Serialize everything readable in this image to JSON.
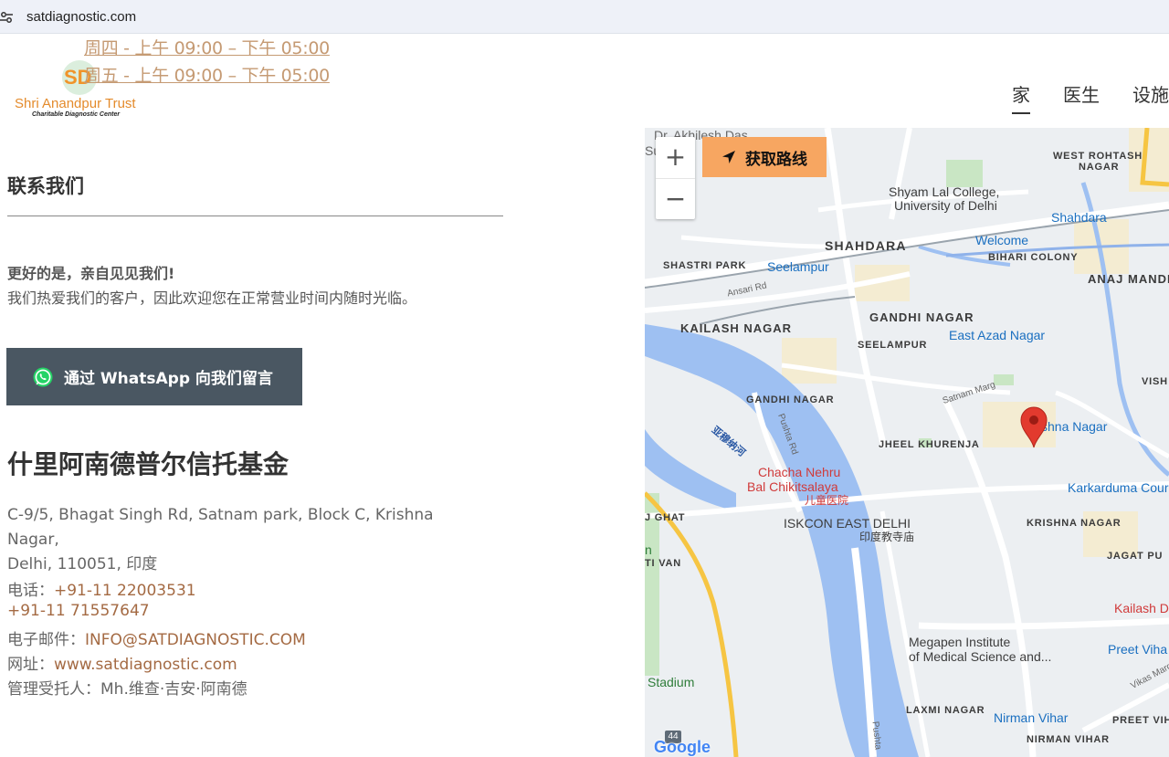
{
  "browser": {
    "url": "satdiagnostic.com"
  },
  "header": {
    "hours": [
      "周四 - 上午 09:00 – 下午 05:00",
      "周五 - 上午 09:00 – 下午 05:00"
    ],
    "logo": {
      "initials": "SD",
      "name": "Shri Anandpur Trust",
      "subtitle": "Charitable Diagnostic Center"
    },
    "nav": [
      "家",
      "医生",
      "设施"
    ]
  },
  "contact": {
    "title": "联系我们",
    "lead_strong": "更好的是，亲自见见我们!",
    "lead_text": "我们热爱我们的客户，因此欢迎您在正常营业时间内随时光临。",
    "whatsapp_label": "通过 WhatsApp 向我们留言",
    "org_name": "什里阿南德普尔信托基金",
    "address_line1": "C-9/5, Bhagat Singh Rd, Satnam park, Block C, Krishna Nagar,",
    "address_line2": "Delhi, 110051, 印度",
    "phone_label": "电话：",
    "phone1": "+91-11 22003531",
    "phone2": "+91-11 71557647",
    "email_label": "电子邮件：",
    "email": "INFO@SATDIAGNOSTIC.COM",
    "website_label": "网址：",
    "website": "www.satdiagnostic.com",
    "trustee_label": "管理受托人：",
    "trustee": "Mh.维查·吉安·阿南德"
  },
  "map": {
    "zoom_in": "+",
    "zoom_out": "−",
    "directions_label": "获取路线",
    "attribution": "Google",
    "highway_shield": "44",
    "labels": {
      "akhilesh": "Dr. Akhilesh Das",
      "su": "Su",
      "west_rohtash": "WEST ROHTASH",
      "nagar_wr": "NAGAR",
      "shyam_lal": "Shyam Lal College,",
      "univ_delhi": "University of Delhi",
      "shahdara_station": "Shahdara",
      "shahdara": "SHAHDARA",
      "welcome": "Welcome",
      "bihari_colony": "BIHARI COLONY",
      "shastri_park": "SHASTRI PARK",
      "seelampur_station": "Seelampur",
      "anaj_mandi": "ANAJ MANDI",
      "ansari_rd": "Ansari Rd",
      "gandhi_nagar_big": "GANDHI NAGAR",
      "kailash_nagar": "KAILASH NAGAR",
      "seelampur": "SEELAMPUR",
      "east_azad": "East Azad Nagar",
      "vish": "VISH",
      "satnam_marg": "Satnam Marg",
      "gandhi_nagar_small": "GANDHI NAGAR",
      "pushta_rd": "Pushta Rd",
      "krishna_nagar_station": "shna Nagar",
      "jheel_khurenja": "JHEEL KHURENJA",
      "yamuna": "亚穆纳河",
      "chacha_nehru": "Chacha Nehru",
      "bal_chikitsalaya": "Bal Chikitsalaya",
      "hospital_cn": "儿童医院",
      "karkarduma": "Karkarduma Cour",
      "j_ghat": "J GHAT",
      "iskcon": "ISKCON EAST DELHI",
      "temple_cn": "印度教寺庙",
      "krishna_nagar": "KRISHNA NAGAR",
      "n": "n",
      "ti_van": "TI VAN",
      "jagat_pu": "JAGAT PU",
      "kailash_d": "Kailash D",
      "megapen1": "Megapen Institute",
      "megapen2": "of Medical Science and...",
      "preet_vihar_station": "Preet Viha",
      "stadium": "Stadium",
      "vikas_marg": "Vikas Marg",
      "laxmi_nagar": "LAXMI NAGAR",
      "nirman_vihar_station": "Nirman Vihar",
      "preet_vihar": "PREET VIH",
      "nirman_vihar": "NIRMAN VIHAR",
      "pushta": "Pushta"
    }
  },
  "colors": {
    "link": "#a46a43",
    "hours": "#c59a73",
    "button_bg": "#4a5762",
    "directions_bg": "#f7a661",
    "whatsapp": "#25d366"
  }
}
